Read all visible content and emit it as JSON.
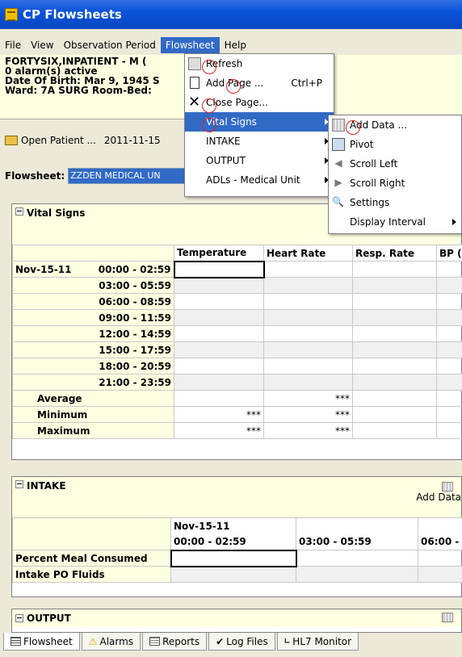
{
  "window": {
    "title": "CP Flowsheets"
  },
  "menubar": [
    "File",
    "View",
    "Observation Period",
    "Flowsheet",
    "Help"
  ],
  "patient": {
    "name": "FORTYSIX,INPATIENT - M (",
    "alarms": "0 alarm(s) active",
    "dob": "Date Of Birth: Mar 9, 1945  S",
    "ward": "Ward: 7A SURG  Room-Bed:"
  },
  "toolbar": {
    "open_patient": "Open Patient ...",
    "date": "2011-11-15"
  },
  "flowsheet": {
    "label": "Flowsheet:",
    "value": "ZZDEN MEDICAL UN"
  },
  "flowsheet_menu": [
    {
      "label": "Refresh",
      "shortcut": ""
    },
    {
      "label": "Add Page ...",
      "shortcut": "Ctrl+P"
    },
    {
      "label": "Close Page...",
      "shortcut": ""
    },
    {
      "label": "Vital Signs",
      "shortcut": ""
    },
    {
      "label": "INTAKE",
      "shortcut": ""
    },
    {
      "label": "OUTPUT",
      "shortcut": ""
    },
    {
      "label": "ADLs - Medical Unit",
      "shortcut": ""
    }
  ],
  "vitals_submenu": [
    "Add Data ...",
    "Pivot",
    "Scroll Left",
    "Scroll Right",
    "Settings",
    "Display Interval"
  ],
  "vital_signs": {
    "title": "Vital Signs",
    "columns": [
      "Temperature",
      "Heart Rate",
      "Resp. Rate",
      "BP ("
    ],
    "date": "Nov-15-11",
    "rows": [
      "00:00 - 02:59",
      "03:00 - 05:59",
      "06:00 - 08:59",
      "09:00 - 11:59",
      "12:00 - 14:59",
      "15:00 - 17:59",
      "18:00 - 20:59",
      "21:00 - 23:59"
    ],
    "summary": [
      {
        "label": "Average",
        "temp": "",
        "hr": "***"
      },
      {
        "label": "Minimum",
        "temp": "***",
        "hr": "***"
      },
      {
        "label": "Maximum",
        "temp": "***",
        "hr": "***"
      }
    ]
  },
  "intake": {
    "title": "INTAKE",
    "add_data": "Add Data",
    "date": "Nov-15-11",
    "cols": [
      "00:00 - 02:59",
      "03:00 - 05:59",
      "06:00 -"
    ],
    "rows": [
      "Percent Meal Consumed",
      "Intake PO Fluids"
    ]
  },
  "output": {
    "title": "OUTPUT"
  },
  "tabs": [
    "Flowsheet",
    "Alarms",
    "Reports",
    "Log Files",
    "HL7 Monitor"
  ]
}
